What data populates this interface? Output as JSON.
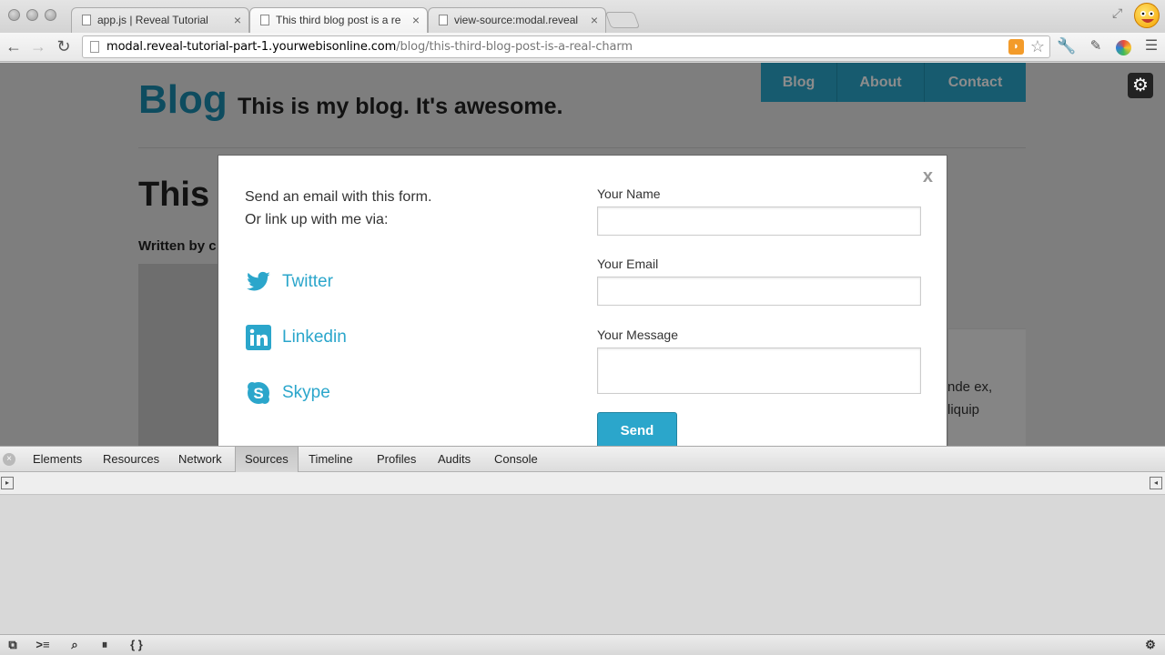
{
  "browser": {
    "tabs": [
      {
        "title": "app.js | Reveal Tutorial",
        "active": false
      },
      {
        "title": "This third blog post is a re",
        "active": true
      },
      {
        "title": "view-source:modal.reveal",
        "active": false
      }
    ],
    "url_host": "modal.reveal-tutorial-part-1.yourwebisonline.com",
    "url_path": "/blog/this-third-blog-post-is-a-real-charm"
  },
  "site": {
    "title": "Blog",
    "tagline": "This is my blog. It's awesome.",
    "nav": [
      "Blog",
      "About",
      "Contact"
    ],
    "post_title_partial": "This",
    "byline_partial": "Written by c",
    "side_text": [
      "nde ex,",
      "liquip"
    ]
  },
  "modal": {
    "close": "x",
    "intro_line1": "Send an email with this form.",
    "intro_line2": "Or link up with me via:",
    "social": [
      {
        "label": "Twitter",
        "icon": "twitter-icon"
      },
      {
        "label": "Linkedin",
        "icon": "linkedin-icon"
      },
      {
        "label": "Skype",
        "icon": "skype-icon"
      }
    ],
    "form": {
      "name_label": "Your Name",
      "email_label": "Your Email",
      "message_label": "Your Message",
      "send_label": "Send"
    }
  },
  "devtools": {
    "tabs": [
      "Elements",
      "Resources",
      "Network",
      "Sources",
      "Timeline",
      "Profiles",
      "Audits",
      "Console"
    ],
    "selected": "Sources"
  },
  "colors": {
    "accent": "#2ba6cb",
    "title": "#1a8aae"
  }
}
